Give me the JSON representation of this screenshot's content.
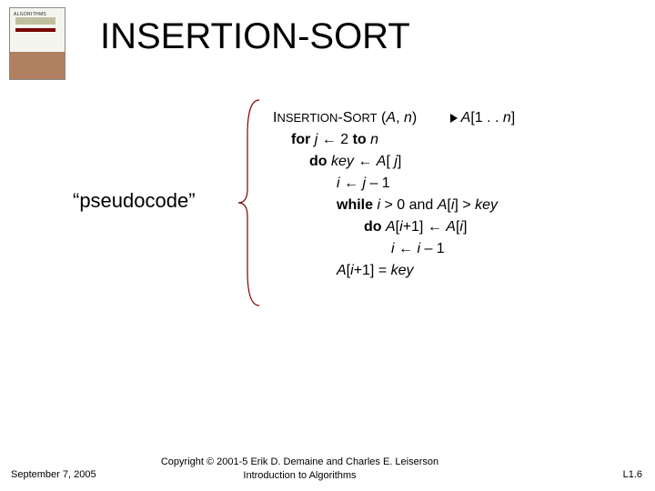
{
  "title": "INSERTION-SORT",
  "book_label": "ALGORITHMS",
  "pseudo_label": "“pseudocode”",
  "code": {
    "l0_head": "I",
    "l0_rest": "NSERTION",
    "l0_dash": "-S",
    "l0_sort": "ORT",
    "l0_open": " (",
    "l0_A": "A",
    "l0_comma": ", ",
    "l0_n": "n",
    "l0_close": ")",
    "l0_cmt_A": "A",
    "l0_cmt_rest": "[1 . . ",
    "l0_cmt_n": "n",
    "l0_cmt_end": "]",
    "l1_for": "for ",
    "l1_j": "j",
    "l1_arrow": " ← ",
    "l1_two": "2",
    "l1_to": " to ",
    "l1_n": "n",
    "l2_do": "do ",
    "l2_key": "key",
    "l2_arrow": " ← ",
    "l2_A": "A",
    "l2_open": "[ ",
    "l2_j": "j",
    "l2_close": "]",
    "l3_i": "i",
    "l3_arrow": " ← ",
    "l3_j": "j",
    "l3_minus": " – 1",
    "l4_while": "while ",
    "l4_i": "i",
    "l4_gt": " > 0 and ",
    "l4_A": "A",
    "l4_open": "[",
    "l4_ii": "i",
    "l4_close": "] > ",
    "l4_key": "key",
    "l5_do": "do ",
    "l5_A1": "A",
    "l5_o1": "[",
    "l5_i1": "i",
    "l5_p1": "+1] ← ",
    "l5_A2": "A",
    "l5_o2": "[",
    "l5_i2": "i",
    "l5_c2": "]",
    "l6_i": "i",
    "l6_arrow": " ← ",
    "l6_ii": "i",
    "l6_minus": " – 1",
    "l7_A": "A",
    "l7_open": "[",
    "l7_i": "i",
    "l7_rest1": "+1] = ",
    "l7_key": "key"
  },
  "footer": {
    "date": "September 7, 2005",
    "copyright": "Copyright © 2001-5 Erik D. Demaine and Charles E. Leiserson",
    "subtitle": "Introduction to Algorithms",
    "page": "L1.6"
  }
}
